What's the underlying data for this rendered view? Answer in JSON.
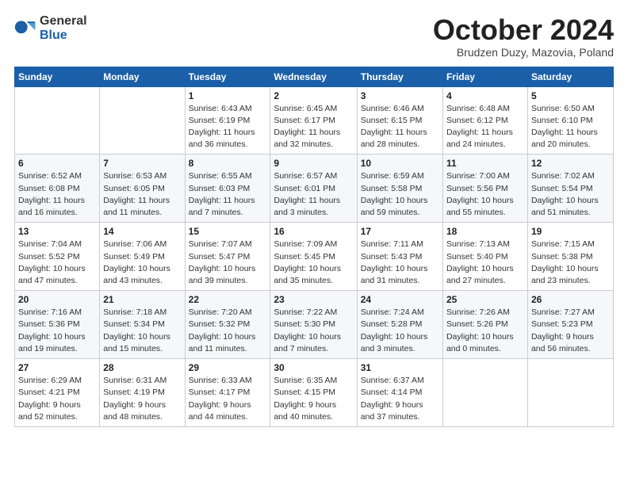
{
  "logo": {
    "general": "General",
    "blue": "Blue"
  },
  "title": "October 2024",
  "subtitle": "Brudzen Duzy, Mazovia, Poland",
  "headers": [
    "Sunday",
    "Monday",
    "Tuesday",
    "Wednesday",
    "Thursday",
    "Friday",
    "Saturday"
  ],
  "weeks": [
    [
      {
        "day": "",
        "info": ""
      },
      {
        "day": "",
        "info": ""
      },
      {
        "day": "1",
        "info": "Sunrise: 6:43 AM\nSunset: 6:19 PM\nDaylight: 11 hours\nand 36 minutes."
      },
      {
        "day": "2",
        "info": "Sunrise: 6:45 AM\nSunset: 6:17 PM\nDaylight: 11 hours\nand 32 minutes."
      },
      {
        "day": "3",
        "info": "Sunrise: 6:46 AM\nSunset: 6:15 PM\nDaylight: 11 hours\nand 28 minutes."
      },
      {
        "day": "4",
        "info": "Sunrise: 6:48 AM\nSunset: 6:12 PM\nDaylight: 11 hours\nand 24 minutes."
      },
      {
        "day": "5",
        "info": "Sunrise: 6:50 AM\nSunset: 6:10 PM\nDaylight: 11 hours\nand 20 minutes."
      }
    ],
    [
      {
        "day": "6",
        "info": "Sunrise: 6:52 AM\nSunset: 6:08 PM\nDaylight: 11 hours\nand 16 minutes."
      },
      {
        "day": "7",
        "info": "Sunrise: 6:53 AM\nSunset: 6:05 PM\nDaylight: 11 hours\nand 11 minutes."
      },
      {
        "day": "8",
        "info": "Sunrise: 6:55 AM\nSunset: 6:03 PM\nDaylight: 11 hours\nand 7 minutes."
      },
      {
        "day": "9",
        "info": "Sunrise: 6:57 AM\nSunset: 6:01 PM\nDaylight: 11 hours\nand 3 minutes."
      },
      {
        "day": "10",
        "info": "Sunrise: 6:59 AM\nSunset: 5:58 PM\nDaylight: 10 hours\nand 59 minutes."
      },
      {
        "day": "11",
        "info": "Sunrise: 7:00 AM\nSunset: 5:56 PM\nDaylight: 10 hours\nand 55 minutes."
      },
      {
        "day": "12",
        "info": "Sunrise: 7:02 AM\nSunset: 5:54 PM\nDaylight: 10 hours\nand 51 minutes."
      }
    ],
    [
      {
        "day": "13",
        "info": "Sunrise: 7:04 AM\nSunset: 5:52 PM\nDaylight: 10 hours\nand 47 minutes."
      },
      {
        "day": "14",
        "info": "Sunrise: 7:06 AM\nSunset: 5:49 PM\nDaylight: 10 hours\nand 43 minutes."
      },
      {
        "day": "15",
        "info": "Sunrise: 7:07 AM\nSunset: 5:47 PM\nDaylight: 10 hours\nand 39 minutes."
      },
      {
        "day": "16",
        "info": "Sunrise: 7:09 AM\nSunset: 5:45 PM\nDaylight: 10 hours\nand 35 minutes."
      },
      {
        "day": "17",
        "info": "Sunrise: 7:11 AM\nSunset: 5:43 PM\nDaylight: 10 hours\nand 31 minutes."
      },
      {
        "day": "18",
        "info": "Sunrise: 7:13 AM\nSunset: 5:40 PM\nDaylight: 10 hours\nand 27 minutes."
      },
      {
        "day": "19",
        "info": "Sunrise: 7:15 AM\nSunset: 5:38 PM\nDaylight: 10 hours\nand 23 minutes."
      }
    ],
    [
      {
        "day": "20",
        "info": "Sunrise: 7:16 AM\nSunset: 5:36 PM\nDaylight: 10 hours\nand 19 minutes."
      },
      {
        "day": "21",
        "info": "Sunrise: 7:18 AM\nSunset: 5:34 PM\nDaylight: 10 hours\nand 15 minutes."
      },
      {
        "day": "22",
        "info": "Sunrise: 7:20 AM\nSunset: 5:32 PM\nDaylight: 10 hours\nand 11 minutes."
      },
      {
        "day": "23",
        "info": "Sunrise: 7:22 AM\nSunset: 5:30 PM\nDaylight: 10 hours\nand 7 minutes."
      },
      {
        "day": "24",
        "info": "Sunrise: 7:24 AM\nSunset: 5:28 PM\nDaylight: 10 hours\nand 3 minutes."
      },
      {
        "day": "25",
        "info": "Sunrise: 7:26 AM\nSunset: 5:26 PM\nDaylight: 10 hours\nand 0 minutes."
      },
      {
        "day": "26",
        "info": "Sunrise: 7:27 AM\nSunset: 5:23 PM\nDaylight: 9 hours\nand 56 minutes."
      }
    ],
    [
      {
        "day": "27",
        "info": "Sunrise: 6:29 AM\nSunset: 4:21 PM\nDaylight: 9 hours\nand 52 minutes."
      },
      {
        "day": "28",
        "info": "Sunrise: 6:31 AM\nSunset: 4:19 PM\nDaylight: 9 hours\nand 48 minutes."
      },
      {
        "day": "29",
        "info": "Sunrise: 6:33 AM\nSunset: 4:17 PM\nDaylight: 9 hours\nand 44 minutes."
      },
      {
        "day": "30",
        "info": "Sunrise: 6:35 AM\nSunset: 4:15 PM\nDaylight: 9 hours\nand 40 minutes."
      },
      {
        "day": "31",
        "info": "Sunrise: 6:37 AM\nSunset: 4:14 PM\nDaylight: 9 hours\nand 37 minutes."
      },
      {
        "day": "",
        "info": ""
      },
      {
        "day": "",
        "info": ""
      }
    ]
  ]
}
